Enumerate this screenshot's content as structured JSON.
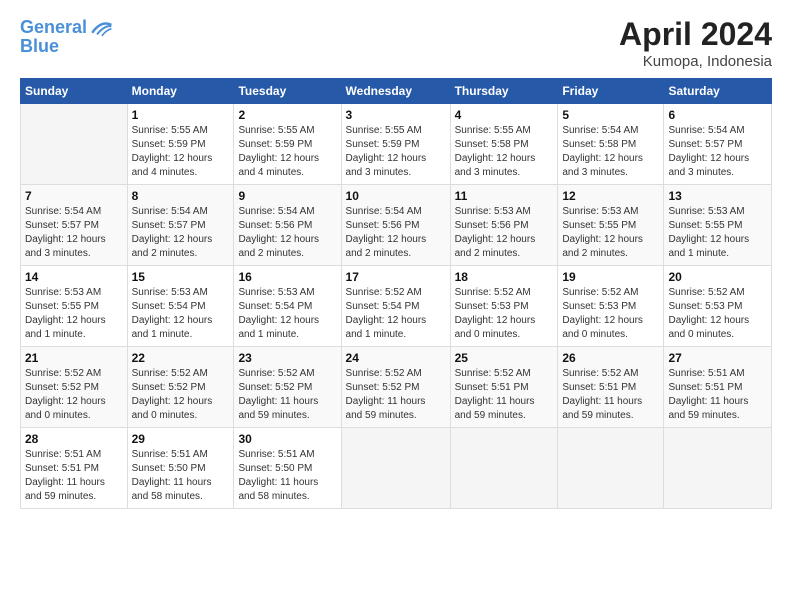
{
  "logo": {
    "line1": "General",
    "line2": "Blue"
  },
  "title": "April 2024",
  "location": "Kumopa, Indonesia",
  "columns": [
    "Sunday",
    "Monday",
    "Tuesday",
    "Wednesday",
    "Thursday",
    "Friday",
    "Saturday"
  ],
  "weeks": [
    [
      {
        "day": "",
        "info": ""
      },
      {
        "day": "1",
        "info": "Sunrise: 5:55 AM\nSunset: 5:59 PM\nDaylight: 12 hours\nand 4 minutes."
      },
      {
        "day": "2",
        "info": "Sunrise: 5:55 AM\nSunset: 5:59 PM\nDaylight: 12 hours\nand 4 minutes."
      },
      {
        "day": "3",
        "info": "Sunrise: 5:55 AM\nSunset: 5:59 PM\nDaylight: 12 hours\nand 3 minutes."
      },
      {
        "day": "4",
        "info": "Sunrise: 5:55 AM\nSunset: 5:58 PM\nDaylight: 12 hours\nand 3 minutes."
      },
      {
        "day": "5",
        "info": "Sunrise: 5:54 AM\nSunset: 5:58 PM\nDaylight: 12 hours\nand 3 minutes."
      },
      {
        "day": "6",
        "info": "Sunrise: 5:54 AM\nSunset: 5:57 PM\nDaylight: 12 hours\nand 3 minutes."
      }
    ],
    [
      {
        "day": "7",
        "info": "Sunrise: 5:54 AM\nSunset: 5:57 PM\nDaylight: 12 hours\nand 3 minutes."
      },
      {
        "day": "8",
        "info": "Sunrise: 5:54 AM\nSunset: 5:57 PM\nDaylight: 12 hours\nand 2 minutes."
      },
      {
        "day": "9",
        "info": "Sunrise: 5:54 AM\nSunset: 5:56 PM\nDaylight: 12 hours\nand 2 minutes."
      },
      {
        "day": "10",
        "info": "Sunrise: 5:54 AM\nSunset: 5:56 PM\nDaylight: 12 hours\nand 2 minutes."
      },
      {
        "day": "11",
        "info": "Sunrise: 5:53 AM\nSunset: 5:56 PM\nDaylight: 12 hours\nand 2 minutes."
      },
      {
        "day": "12",
        "info": "Sunrise: 5:53 AM\nSunset: 5:55 PM\nDaylight: 12 hours\nand 2 minutes."
      },
      {
        "day": "13",
        "info": "Sunrise: 5:53 AM\nSunset: 5:55 PM\nDaylight: 12 hours\nand 1 minute."
      }
    ],
    [
      {
        "day": "14",
        "info": "Sunrise: 5:53 AM\nSunset: 5:55 PM\nDaylight: 12 hours\nand 1 minute."
      },
      {
        "day": "15",
        "info": "Sunrise: 5:53 AM\nSunset: 5:54 PM\nDaylight: 12 hours\nand 1 minute."
      },
      {
        "day": "16",
        "info": "Sunrise: 5:53 AM\nSunset: 5:54 PM\nDaylight: 12 hours\nand 1 minute."
      },
      {
        "day": "17",
        "info": "Sunrise: 5:52 AM\nSunset: 5:54 PM\nDaylight: 12 hours\nand 1 minute."
      },
      {
        "day": "18",
        "info": "Sunrise: 5:52 AM\nSunset: 5:53 PM\nDaylight: 12 hours\nand 0 minutes."
      },
      {
        "day": "19",
        "info": "Sunrise: 5:52 AM\nSunset: 5:53 PM\nDaylight: 12 hours\nand 0 minutes."
      },
      {
        "day": "20",
        "info": "Sunrise: 5:52 AM\nSunset: 5:53 PM\nDaylight: 12 hours\nand 0 minutes."
      }
    ],
    [
      {
        "day": "21",
        "info": "Sunrise: 5:52 AM\nSunset: 5:52 PM\nDaylight: 12 hours\nand 0 minutes."
      },
      {
        "day": "22",
        "info": "Sunrise: 5:52 AM\nSunset: 5:52 PM\nDaylight: 12 hours\nand 0 minutes."
      },
      {
        "day": "23",
        "info": "Sunrise: 5:52 AM\nSunset: 5:52 PM\nDaylight: 11 hours\nand 59 minutes."
      },
      {
        "day": "24",
        "info": "Sunrise: 5:52 AM\nSunset: 5:52 PM\nDaylight: 11 hours\nand 59 minutes."
      },
      {
        "day": "25",
        "info": "Sunrise: 5:52 AM\nSunset: 5:51 PM\nDaylight: 11 hours\nand 59 minutes."
      },
      {
        "day": "26",
        "info": "Sunrise: 5:52 AM\nSunset: 5:51 PM\nDaylight: 11 hours\nand 59 minutes."
      },
      {
        "day": "27",
        "info": "Sunrise: 5:51 AM\nSunset: 5:51 PM\nDaylight: 11 hours\nand 59 minutes."
      }
    ],
    [
      {
        "day": "28",
        "info": "Sunrise: 5:51 AM\nSunset: 5:51 PM\nDaylight: 11 hours\nand 59 minutes."
      },
      {
        "day": "29",
        "info": "Sunrise: 5:51 AM\nSunset: 5:50 PM\nDaylight: 11 hours\nand 58 minutes."
      },
      {
        "day": "30",
        "info": "Sunrise: 5:51 AM\nSunset: 5:50 PM\nDaylight: 11 hours\nand 58 minutes."
      },
      {
        "day": "",
        "info": ""
      },
      {
        "day": "",
        "info": ""
      },
      {
        "day": "",
        "info": ""
      },
      {
        "day": "",
        "info": ""
      }
    ]
  ]
}
